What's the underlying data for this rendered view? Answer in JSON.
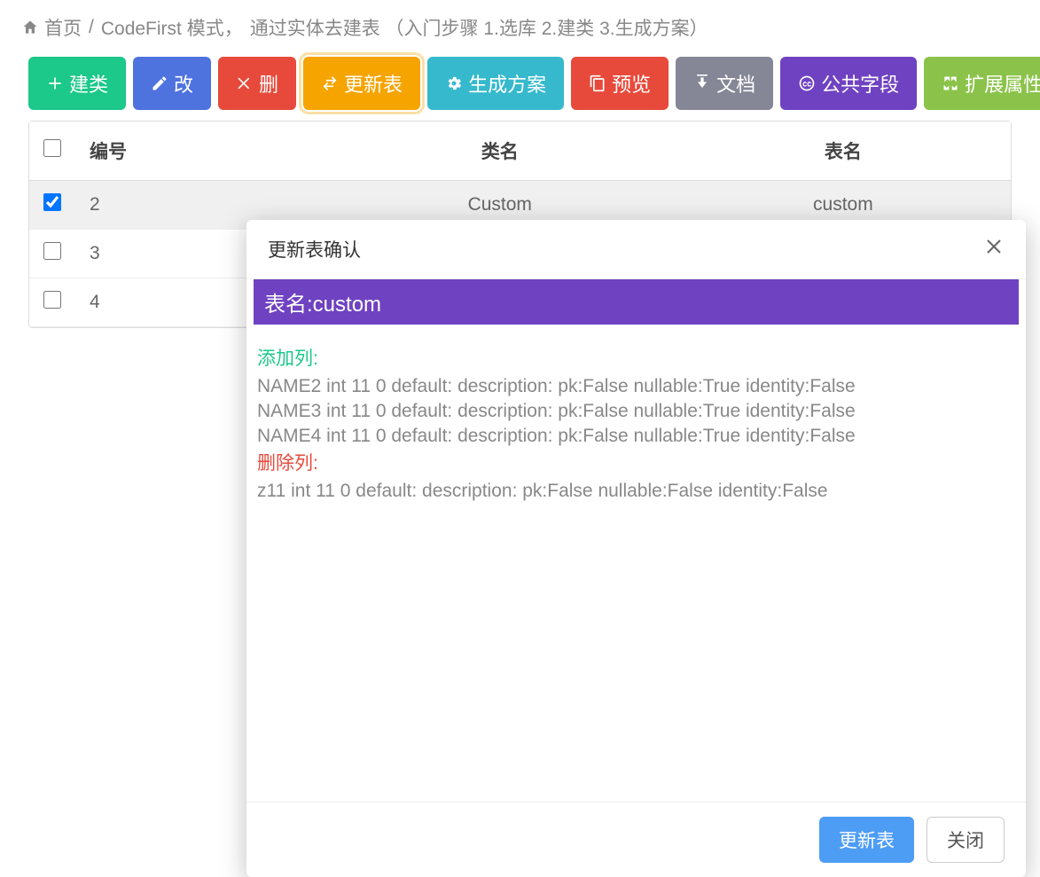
{
  "breadcrumb": {
    "home": "首页",
    "section": "CodeFirst 模式，",
    "desc": "通过实体去建表 （入门步骤 1.选库 2.建类 3.生成方案）"
  },
  "toolbar": {
    "new_class": "建类",
    "edit": "改",
    "delete": "删",
    "update_table": "更新表",
    "gen_plan": "生成方案",
    "preview": "预览",
    "doc": "文档",
    "public_fields": "公共字段",
    "ext_attrs": "扩展属性"
  },
  "table": {
    "headers": {
      "id": "编号",
      "class_name": "类名",
      "table_name": "表名"
    },
    "rows": [
      {
        "id": "2",
        "class_name": "Custom",
        "table_name": "custom",
        "checked": true
      },
      {
        "id": "3",
        "class_name": "",
        "table_name": "",
        "checked": false
      },
      {
        "id": "4",
        "class_name": "",
        "table_name": "",
        "checked": false
      }
    ]
  },
  "modal": {
    "title": "更新表确认",
    "table_label_prefix": "表名:",
    "table_name": "custom",
    "add_label": "添加列:",
    "add_lines": [
      "NAME2 int 11 0 default: description: pk:False nullable:True identity:False",
      "NAME3 int 11 0 default: description: pk:False nullable:True identity:False",
      "NAME4 int 11 0 default: description: pk:False nullable:True identity:False"
    ],
    "del_label": "删除列:",
    "del_lines": [
      "z11 int 11 0 default: description: pk:False nullable:False identity:False"
    ],
    "confirm_label": "更新表",
    "cancel_label": "关闭"
  }
}
